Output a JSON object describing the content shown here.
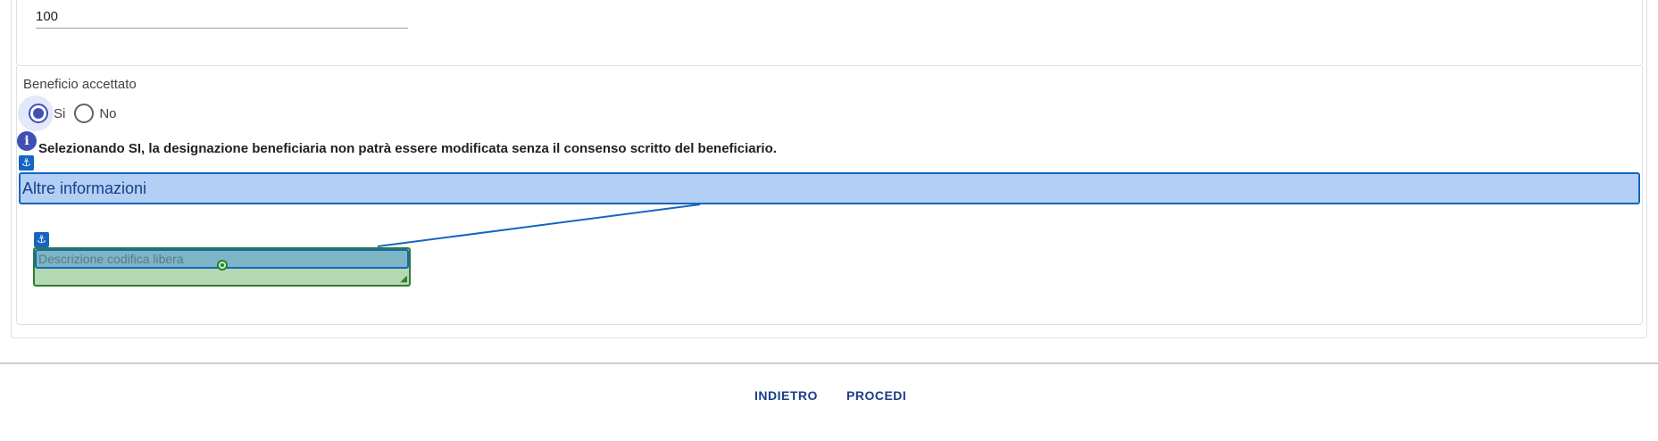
{
  "top_field": {
    "label": "",
    "value": "100"
  },
  "benefit": {
    "label": "Beneficio accettato",
    "options": [
      {
        "label": "Si",
        "checked": true
      },
      {
        "label": "No",
        "checked": false
      }
    ]
  },
  "info": {
    "icon": "info-icon",
    "text": "Selezionando SI, la designazione beneficiaria non patrà essere modificata senza il consenso scritto del beneficiario."
  },
  "section": {
    "title": "Altre informazioni"
  },
  "description": {
    "placeholder": "Descrizione codifica libera"
  },
  "anchor_icon": "⚓",
  "footer": {
    "back_label": "INDIETRO",
    "next_label": "PROCEDI"
  },
  "colors": {
    "accent": "#3f51b5",
    "banner": "#b3cff5",
    "footer_text": "#1a3e8a"
  }
}
